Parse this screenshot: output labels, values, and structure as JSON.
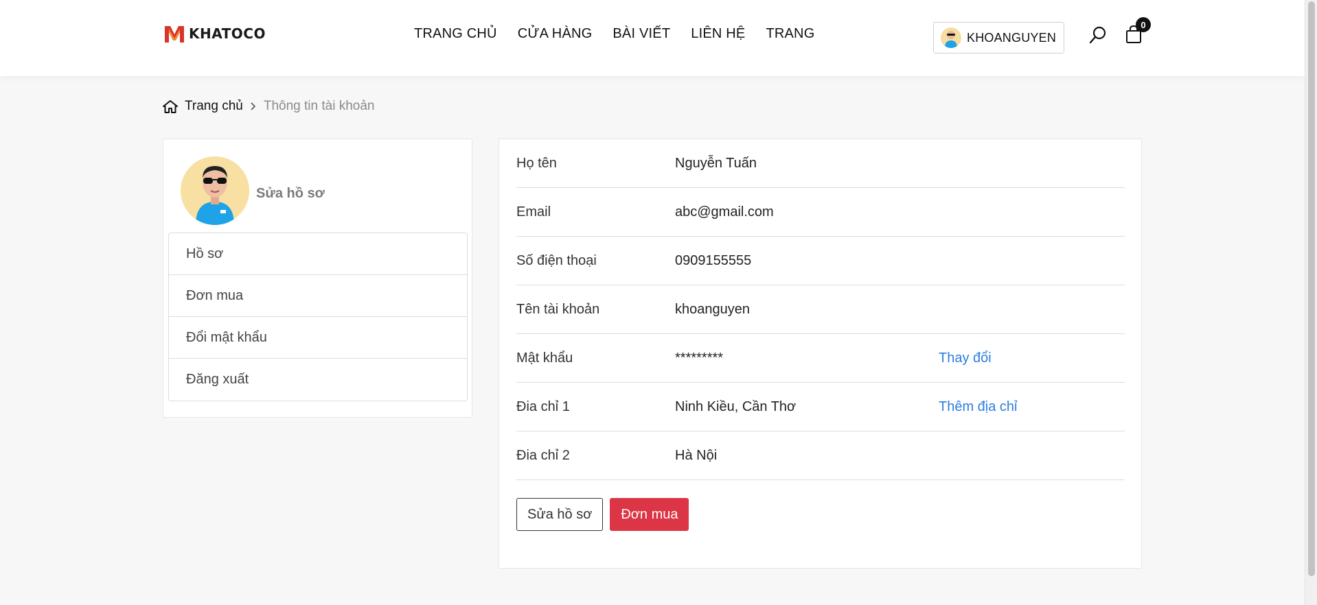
{
  "brand": {
    "logo_text": "KHATOCO"
  },
  "nav": {
    "items": [
      "TRANG CHỦ",
      "CỬA HÀNG",
      "BÀI VIẾT",
      "LIÊN HỆ",
      "TRANG"
    ]
  },
  "header": {
    "username": "KHOANGUYEN",
    "cart_count": "0"
  },
  "breadcrumb": {
    "home": "Trang chủ",
    "current": "Thông tin tài khoản"
  },
  "sidebar": {
    "edit_title": "Sửa hồ sơ",
    "items": [
      "Hồ sơ",
      "Đơn mua",
      "Đổi mật khẩu",
      "Đăng xuất"
    ]
  },
  "profile": {
    "rows": [
      {
        "label": "Họ tên",
        "value": "Nguyễn Tuấn",
        "action": ""
      },
      {
        "label": "Email",
        "value": "abc@gmail.com",
        "action": ""
      },
      {
        "label": "Số điện thoại",
        "value": "0909155555",
        "action": ""
      },
      {
        "label": "Tên tài khoản",
        "value": "khoanguyen",
        "action": ""
      },
      {
        "label": "Mật khẩu",
        "value": "*********",
        "action": "Thay đổi"
      },
      {
        "label": "Đia chỉ 1",
        "value": "Ninh Kiều, Cần Thơ",
        "action": "Thêm địa chỉ"
      },
      {
        "label": "Đia chỉ 2",
        "value": "Hà Nội",
        "action": ""
      }
    ],
    "edit_button": "Sửa hồ sơ",
    "orders_button": "Đơn mua"
  },
  "colors": {
    "accent_red": "#dc3545",
    "link_blue": "#2a7de1",
    "logo_red": "#d8342b"
  }
}
